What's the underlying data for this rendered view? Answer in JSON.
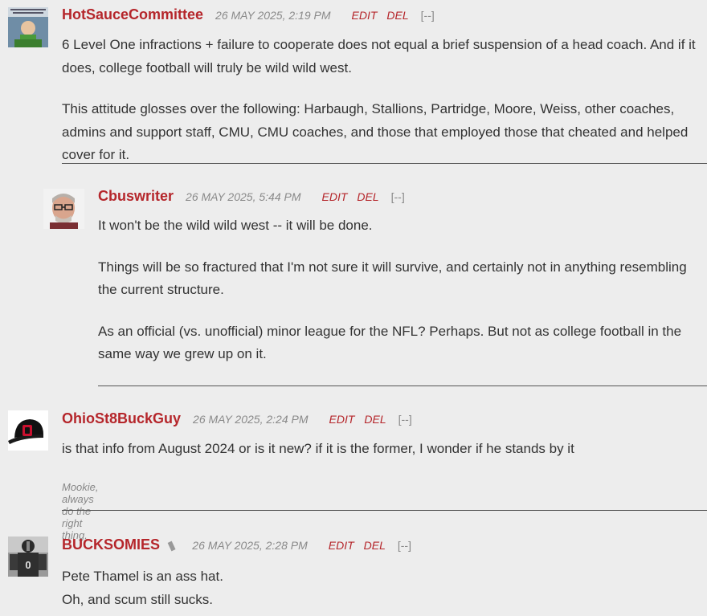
{
  "comments": [
    {
      "username": "HotSauceCommittee",
      "timestamp": "26 MAY 2025, 2:19 PM",
      "edit_label": "EDIT",
      "del_label": "DEL",
      "collapse_label": "[--]",
      "paragraphs": [
        "6 Level One infractions + failure to cooperate does not equal a brief suspension of a head coach. And if it does, college football will truly be wild wild west.",
        "This attitude glosses over the following: Harbaugh, Stallions, Partridge, Moore, Weiss, other coaches, admins and support staff, CMU, CMU coaches, and those that employed those that cheated and helped cover for it."
      ]
    },
    {
      "username": "Cbuswriter",
      "timestamp": "26 MAY 2025, 5:44 PM",
      "edit_label": "EDIT",
      "del_label": "DEL",
      "collapse_label": "[--]",
      "paragraphs": [
        "It won't be the wild wild west -- it will be done.",
        "Things will be so fractured that I'm not sure it will survive, and certainly not in anything resembling the current structure.",
        "As an official (vs. unofficial) minor league for the NFL? Perhaps. But not as college football in the same way we grew up on it."
      ]
    },
    {
      "username": "OhioSt8BuckGuy",
      "timestamp": "26 MAY 2025, 2:24 PM",
      "edit_label": "EDIT",
      "del_label": "DEL",
      "collapse_label": "[--]",
      "paragraphs": [
        "is that info from August 2024 or is it new? if it is the former, I wonder if he stands by it"
      ],
      "signature": "Mookie, always do the right thing."
    },
    {
      "username": "BUCKSOMIES",
      "timestamp": "26 MAY 2025, 2:28 PM",
      "edit_label": "EDIT",
      "del_label": "DEL",
      "collapse_label": "[--]",
      "paragraphs": [
        "Pete Thamel is an ass hat.",
        "Oh, and scum still sucks."
      ]
    }
  ],
  "colors": {
    "background": "#ededed",
    "username": "#b5262b",
    "action": "#b5262b",
    "timestamp": "#8a8a8a",
    "body": "#333333"
  }
}
